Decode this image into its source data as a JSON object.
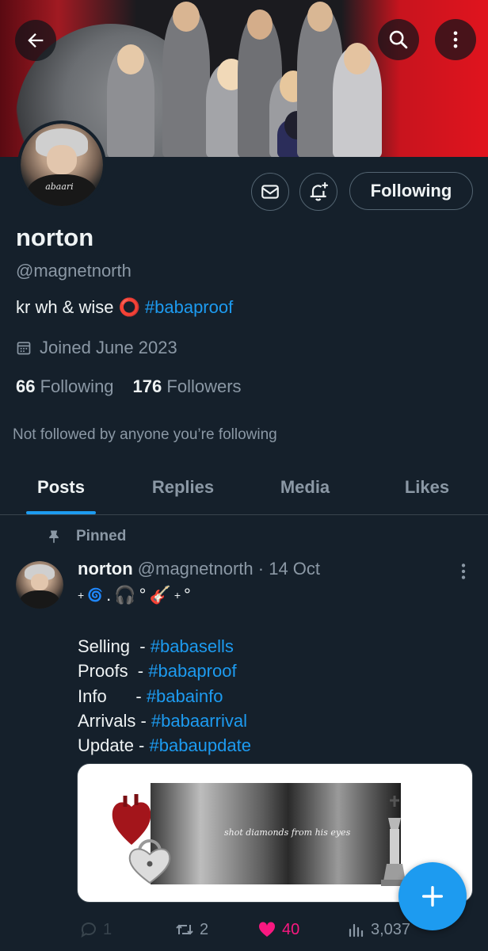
{
  "profile": {
    "name": "norton",
    "handle": "@magnetnorth",
    "bio_text": "kr wh & wise",
    "bio_emoji": "⭕",
    "bio_hashtag": "#babaproof",
    "joined": "Joined June 2023",
    "following_count": "66",
    "following_label": "Following",
    "followers_count": "176",
    "followers_label": "Followers",
    "not_followed_note": "Not followed by anyone you’re following",
    "avatar_shirt_text": "abaari"
  },
  "header": {
    "back_icon": "arrow-left-icon",
    "search_icon": "search-icon",
    "more_icon": "more-vertical-icon"
  },
  "actions": {
    "message_icon": "envelope-icon",
    "notify_icon": "bell-plus-icon",
    "following_button": "Following"
  },
  "tabs": [
    {
      "label": "Posts",
      "active": true
    },
    {
      "label": "Replies",
      "active": false
    },
    {
      "label": "Media",
      "active": false
    },
    {
      "label": "Likes",
      "active": false
    }
  ],
  "pinned_post": {
    "pinned_label": "Pinned",
    "author_name": "norton",
    "author_handle": "@magnetnorth",
    "separator": "·",
    "date": "14 Oct",
    "deco_line": [
      "+",
      "🌀",
      ".",
      "🎧",
      "°",
      "🎸",
      "+",
      "°"
    ],
    "lines": [
      {
        "label": "Selling  - ",
        "tag": "#babasells"
      },
      {
        "label": "Proofs  - ",
        "tag": "#babaproof"
      },
      {
        "label": "Info      - ",
        "tag": "#babainfo"
      },
      {
        "label": "Arrivals - ",
        "tag": "#babaarrival"
      },
      {
        "label": "Update - ",
        "tag": "#babaupdate"
      }
    ],
    "media_caption": "shot diamonds from his eyes",
    "replies": "1",
    "reposts": "2",
    "likes": "40",
    "views": "3,037"
  },
  "colors": {
    "background": "#15202b",
    "accent": "#1d9bf0",
    "like": "#f91880",
    "muted": "#8b98a5"
  },
  "fab": {
    "icon": "plus-icon"
  }
}
